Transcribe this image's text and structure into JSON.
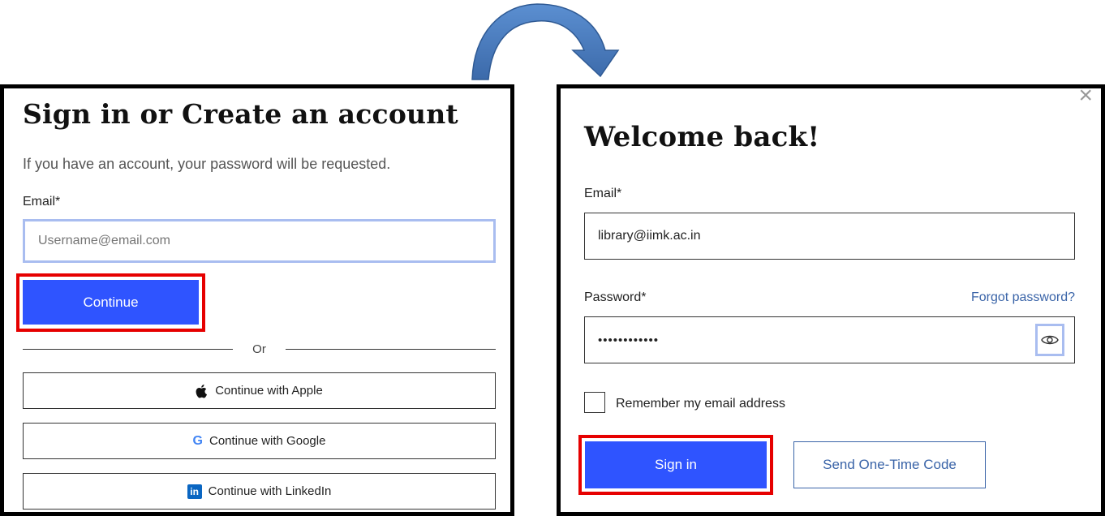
{
  "left": {
    "title": "Sign in or Create an account",
    "subtitle": "If you have an account, your password will be requested.",
    "email_label": "Email*",
    "email_placeholder": "Username@email.com",
    "continue_label": "Continue",
    "or_label": "Or",
    "apple_label": "Continue with Apple",
    "google_label": "Continue with Google",
    "linkedin_label": "Continue with LinkedIn",
    "google_glyph": "G",
    "linkedin_glyph": "in"
  },
  "right": {
    "title": "Welcome back!",
    "close_glyph": "×",
    "email_label": "Email*",
    "email_value": "library@iimk.ac.in",
    "password_label": "Password*",
    "forgot_label": "Forgot password?",
    "password_value": "••••••••••••",
    "remember_label": "Remember my email address",
    "signin_label": "Sign in",
    "otp_label": "Send One-Time Code"
  },
  "colors": {
    "primary": "#2f54ff",
    "highlight": "#e60000",
    "arrow": "#4a7bbf",
    "link": "#3a64a8",
    "focus": "#a9bdf0"
  },
  "icons": [
    "curved-arrow-icon",
    "apple-icon",
    "google-icon",
    "linkedin-icon",
    "close-icon",
    "eye-icon"
  ]
}
